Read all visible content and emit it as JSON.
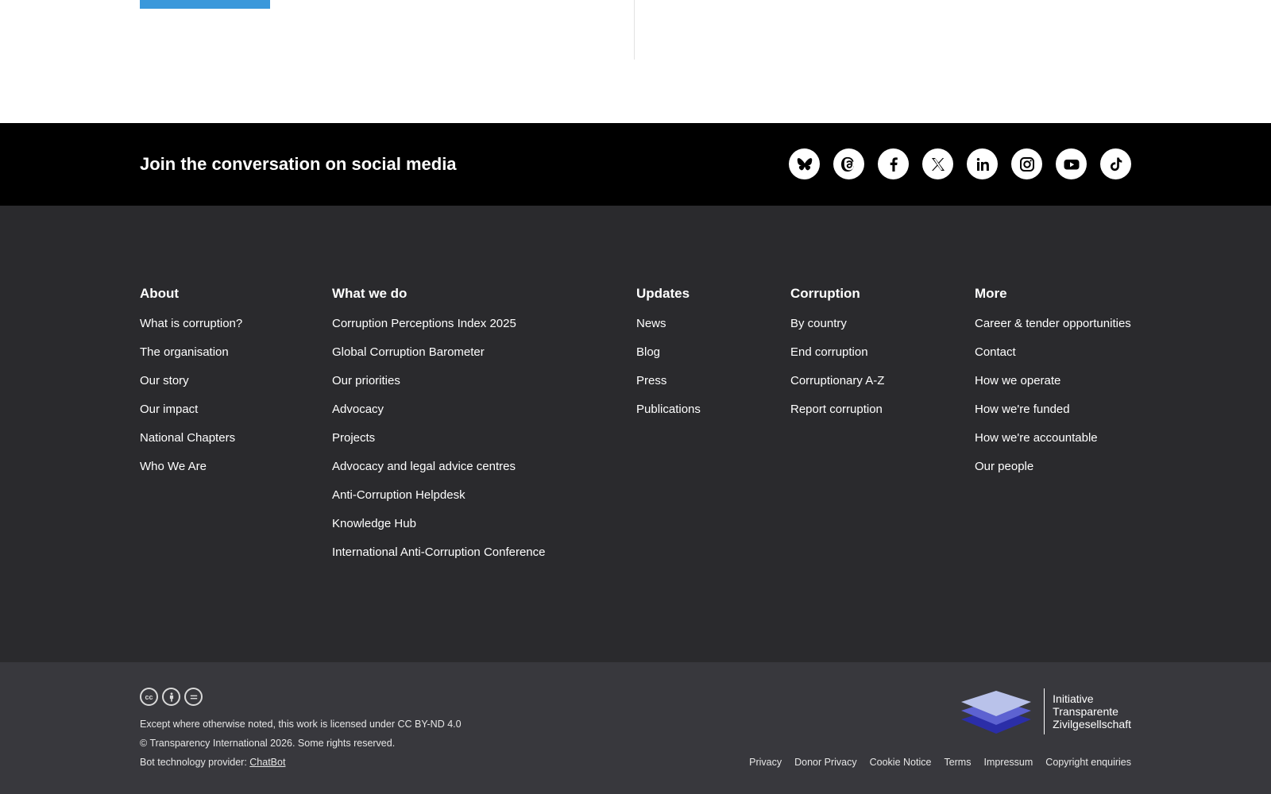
{
  "social": {
    "heading": "Join the conversation on social media",
    "icons": [
      "bluesky-icon",
      "threads-icon",
      "facebook-icon",
      "x-icon",
      "linkedin-icon",
      "instagram-icon",
      "youtube-icon",
      "tiktok-icon"
    ]
  },
  "footer": {
    "about": {
      "title": "About",
      "links": [
        "What is corruption?",
        "The organisation",
        "Our story",
        "Our impact",
        "National Chapters",
        "Who We Are"
      ]
    },
    "what_we_do": {
      "title": "What we do",
      "links": [
        "Corruption Perceptions Index 2025",
        "Global Corruption Barometer",
        "Our priorities",
        "Advocacy",
        "Projects",
        "Advocacy and legal advice centres",
        "Anti-Corruption Helpdesk",
        "Knowledge Hub",
        "International Anti-Corruption Conference"
      ]
    },
    "updates": {
      "title": "Updates",
      "links": [
        "News",
        "Blog",
        "Press",
        "Publications"
      ]
    },
    "corruption": {
      "title": "Corruption",
      "links": [
        "By country",
        "End corruption",
        "Corruptionary A-Z",
        "Report corruption"
      ]
    },
    "more": {
      "title": "More",
      "links": [
        "Career & tender opportunities",
        "Contact",
        "How we operate",
        "How we're funded",
        "How we're accountable",
        "Our people"
      ]
    }
  },
  "bottom": {
    "cc_icons": [
      "cc-icon",
      "by-icon",
      "nd-icon"
    ],
    "license": "Except where otherwise noted, this work is licensed under CC BY-ND 4.0",
    "copyright": "© Transparency International 2026. Some rights reserved.",
    "bot_prefix": "Bot technology provider: ",
    "bot_link": "ChatBot",
    "partner": {
      "line1": "Initiative",
      "line2": "Transparente",
      "line3": "Zivilgesellschaft"
    },
    "legal_links": [
      "Privacy",
      "Donor Privacy",
      "Cookie Notice",
      "Terms",
      "Impressum",
      "Copyright enquiries"
    ]
  },
  "colors": {
    "accent_blue": "#3a98db",
    "social_bar": "#000000",
    "footer_main": "#2a2a2d",
    "footer_bottom": "#38383d"
  }
}
